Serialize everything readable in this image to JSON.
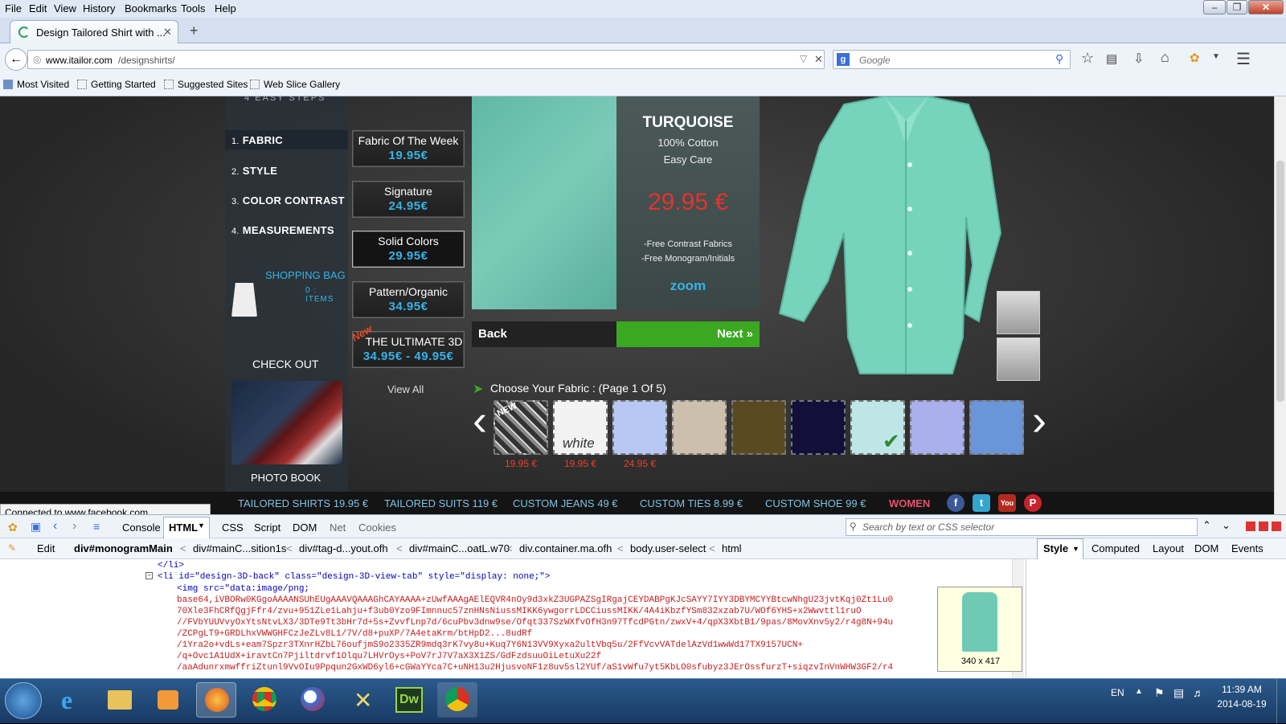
{
  "menubar": {
    "items": [
      "File",
      "Edit",
      "View",
      "History",
      "Bookmarks",
      "Tools",
      "Help"
    ]
  },
  "tab": {
    "title": "Design Tailored Shirt with ..."
  },
  "navbar": {
    "url_host": "www.itailor.com",
    "url_path": "/designshirts/",
    "search_placeholder": "Google"
  },
  "bookmarks": [
    "Most Visited",
    "Getting Started",
    "Suggested Sites",
    "Web Slice Gallery"
  ],
  "site": {
    "header_steps": "4 EASY STEPS",
    "steps": [
      {
        "num": "1.",
        "label": "FABRIC"
      },
      {
        "num": "2.",
        "label": "STYLE"
      },
      {
        "num": "3.",
        "label": "COLOR CONTRAST"
      },
      {
        "num": "4.",
        "label": "MEASUREMENTS"
      }
    ],
    "shopping_bag": "SHOPPING BAG",
    "bag_items": "0 : ITEMS",
    "checkout": "CHECK OUT",
    "photo_book": "PHOTO BOOK",
    "price_boxes": [
      {
        "title": "Fabric Of The Week",
        "price": "19.95€"
      },
      {
        "title": "Signature",
        "price": "24.95€"
      },
      {
        "title": "Solid Colors",
        "price": "29.95€"
      },
      {
        "title": "Pattern/Organic",
        "price": "34.95€"
      },
      {
        "title": "THE ULTIMATE 3D",
        "price": "34.95€ - 49.95€",
        "badge": "New"
      }
    ],
    "view_all": "View All",
    "fabric": {
      "name": "TURQUOISE",
      "material": "100% Cotton",
      "care": "Easy Care",
      "price": "29.95 €",
      "perk1": "-Free Contrast Fabrics",
      "perk2": "-Free Monogram/Initials",
      "zoom": "zoom"
    },
    "back": "Back",
    "next": "Next »",
    "choose_fabric": "Choose Your Fabric : (Page 1 Of 5)",
    "swatches": [
      {
        "label": "NEW",
        "price": "19.95 €",
        "color": "#555"
      },
      {
        "label": "white",
        "price": "19.95 €",
        "color": "#f2f2f2"
      },
      {
        "label": "",
        "price": "24.95 €",
        "color": "#b9c8f2"
      },
      {
        "label": "",
        "price": "",
        "color": "#cdbfae"
      },
      {
        "label": "",
        "price": "",
        "color": "#5a4a22"
      },
      {
        "label": "",
        "price": "",
        "color": "#12103a"
      },
      {
        "label": "",
        "price": "",
        "color": "#bfe6e6"
      },
      {
        "label": "",
        "price": "",
        "color": "#aab0ec"
      },
      {
        "label": "",
        "price": "",
        "color": "#6a95d8"
      }
    ],
    "footer_links": [
      "TAILORED SHIRTS 19.95 €",
      "TAILORED SUITS 119 €",
      "CUSTOM JEANS 49 €",
      "CUSTOM TIES 8.99 €",
      "CUSTOM SHOE 99 €",
      "WOMEN"
    ],
    "social": [
      "f",
      "t",
      "You",
      "P"
    ]
  },
  "status": "Connected to www.facebook.com...",
  "firebug": {
    "tabs": [
      "Console",
      "HTML",
      "CSS",
      "Script",
      "DOM",
      "Net",
      "Cookies"
    ],
    "search_placeholder": "Search by text or CSS selector",
    "edit": "Edit",
    "breadcrumbs": [
      "div#monogramMain",
      "div#mainC...sition1s",
      "div#tag-d...yout.ofh",
      "div#mainC...oatL.w70",
      "div.container.ma.ofh",
      "body.user-select",
      "html"
    ],
    "side_tabs": [
      "Style",
      "Computed",
      "Layout",
      "DOM",
      "Events"
    ],
    "code_lines": [
      "</li>",
      "<li id=\"design-3D-back\" class=\"design-3D-view-tab\" style=\"display: none;\">",
      "<img src=\"data:image/png;",
      "base64,iVBORw0KGgoAAAANSUhEUgAAAVQAAAGhCAYAAAA+zUwfAAAgAElEQVR4nOy9d3xkZ3UGPAZSgIRgajCEYDABPgKJcSAYY7IYY3DBYMCYYBtcwNhgU23jvtKqj0Zt1Lu0",
      "70Xle3FhCRfQgjFfr4/zvu+951ZLe1Lahju+f3ub0Yzo9FImnnuc57znHNsNiussMIKK6ywgorrLDCCiussMIKK/4A4iKbzfYSm832xzab7U/WOf6YHS+x2Wwvttl1ruO",
      "//FVbYUUVvyOxYtsNtvLX3/3DTe9Tt3bHr7d+5s+ZvvfLnp7d/6cuPbv3dnw9se/Ofqt337SzWXfvOfH3n97TfcdPGtn/zwxV+4/qpX3XbtB1/9pas/8MovXnv5y2/r4g8N+94u",
      "/ZCPgLT9+GRDLhxVWWGHFCzJeZLv8L1/7V/d8+puXP/7A4etaKrm/btHpD2...8udRf",
      "/1Yra2o+vdLs+eam7Spzr3TXnrHZbL76oufjmS9o2335ZR9mdq3rK7vy8u+Kuq7Y6N13VV9Xyxa2ultVbq5u/2FfVcvVATdelAzVd1wwWd17TX9157UCN+",
      "/q+Ovc1A1UdX+iravtCn7Pjiltdrvf1Olqu7LHVrOys+PoV7rJ7V7aX3X1ZS/GdFzdsuuOiLetuXu22f",
      "/aaAdunrxmwffriZtunl9VvOIu9Ppqun2GxWD6yl6+cGWaYYca7C+uNH13u2HjusvoNF1z8uv5sl2YUf/aS1vWfu7yt5KbLO0sfubyz3JErOssfurzT+siqzvInVnWHW3GF2/r4"
    ],
    "preview_size": "340 x 417"
  },
  "taskbar": {
    "lang": "EN",
    "time": "11:39 AM",
    "date": "2014-08-19"
  }
}
